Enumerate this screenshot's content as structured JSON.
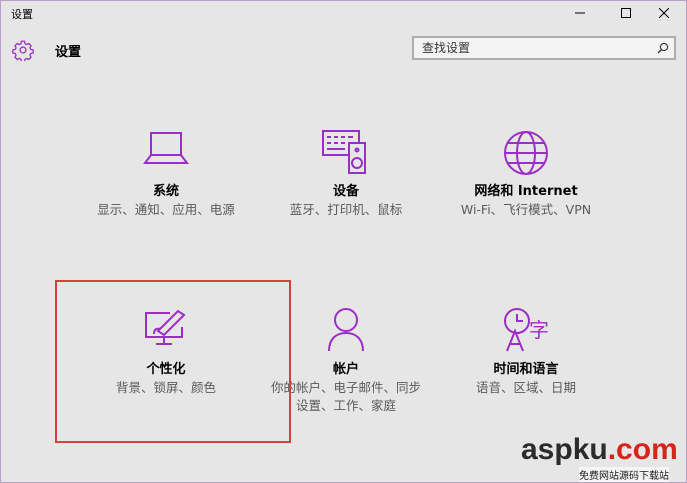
{
  "window": {
    "title": "设置"
  },
  "header": {
    "title": "设置"
  },
  "search": {
    "placeholder": "查找设置"
  },
  "accent_color": "#9b2ec6",
  "highlight_color": "#d9403b",
  "tiles": [
    {
      "title": "系统",
      "description": "显示、通知、应用、电源",
      "icon": "laptop-icon"
    },
    {
      "title": "设备",
      "description": "蓝牙、打印机、鼠标",
      "icon": "devices-icon"
    },
    {
      "title": "网络和 Internet",
      "description": "Wi-Fi、飞行模式、VPN",
      "icon": "globe-icon"
    },
    {
      "title": "个性化",
      "description": "背景、锁屏、颜色",
      "icon": "paintbrush-monitor-icon"
    },
    {
      "title": "帐户",
      "description": "你的帐户、电子邮件、同步设置、工作、家庭",
      "icon": "person-icon"
    },
    {
      "title": "时间和语言",
      "description": "语音、区域、日期",
      "icon": "clock-language-icon"
    }
  ],
  "watermark": {
    "main": "aspku",
    "suffix": ".com",
    "sub": "免费网站源码下载站"
  }
}
